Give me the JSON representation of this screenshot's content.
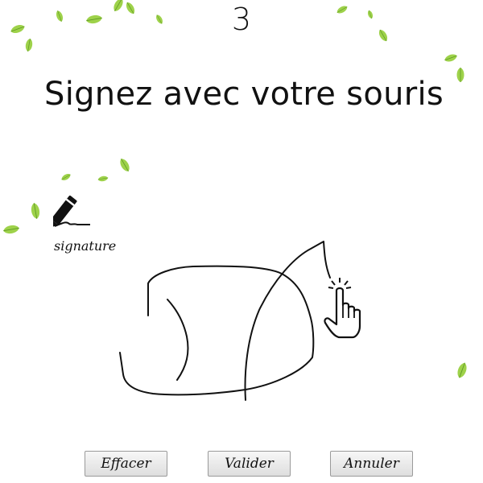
{
  "step": {
    "number": "3"
  },
  "page": {
    "title": "Signez avec votre souris"
  },
  "signature": {
    "label": "signature",
    "icon": "pen-signature-icon"
  },
  "cursor": {
    "icon": "hand-pointer-icon"
  },
  "buttons": {
    "clear": "Effacer",
    "validate": "Valider",
    "cancel": "Annuler"
  },
  "colors": {
    "leaf_light": "#b8e05a",
    "leaf_dark": "#6fae2a",
    "ink": "#111111"
  }
}
